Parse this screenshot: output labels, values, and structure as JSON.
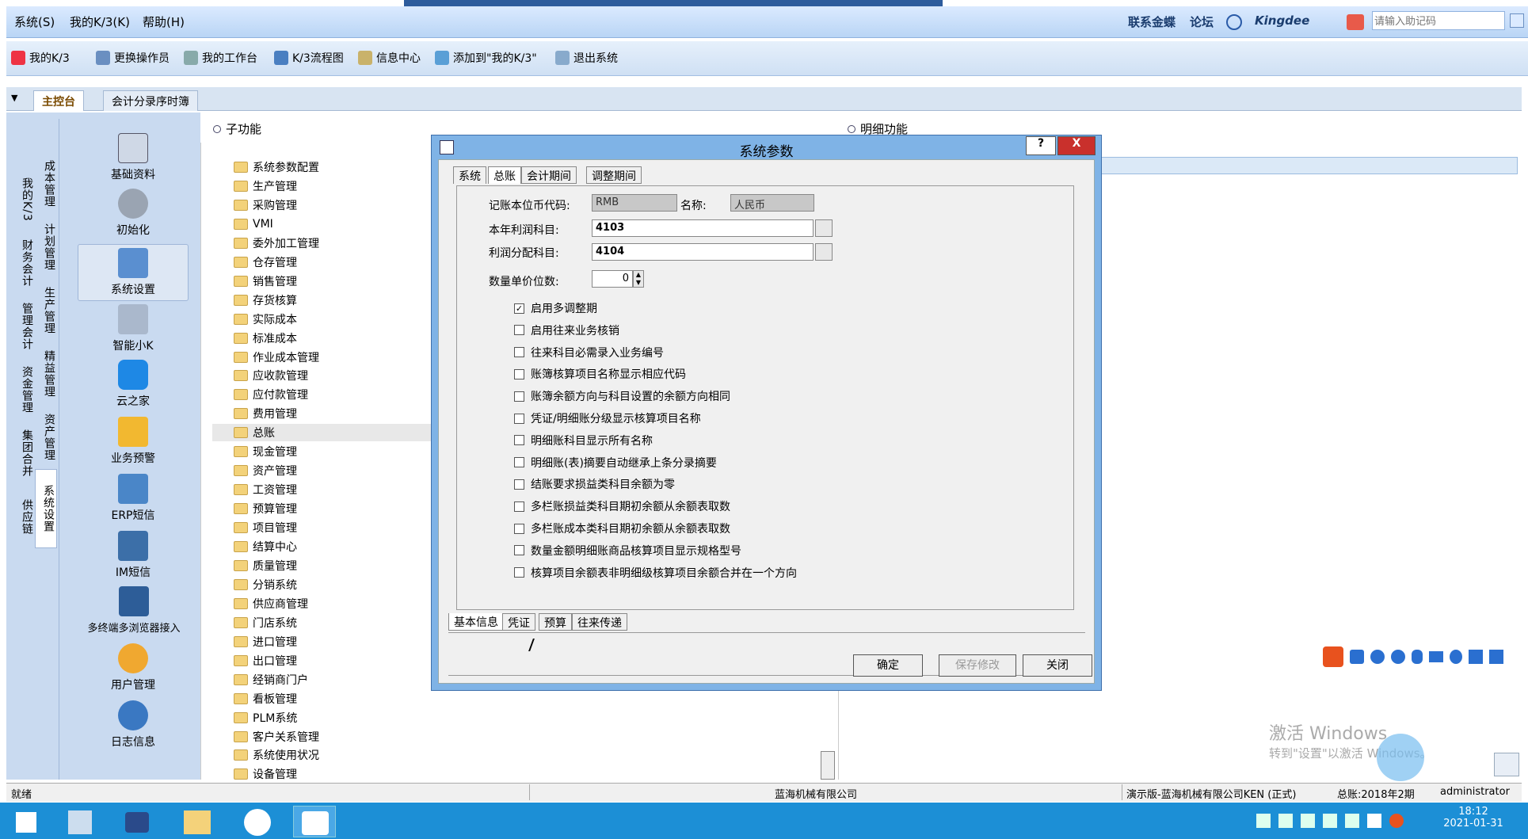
{
  "menubar": {
    "items": [
      "系统(S)",
      "我的K/3(K)",
      "帮助(H)"
    ],
    "links": [
      "联系金蝶",
      "论坛"
    ],
    "brand": "Kingdee",
    "search_placeholder": "请输入助记码"
  },
  "toolbar": {
    "items": [
      "我的K/3",
      "更换操作员",
      "我的工作台",
      "K/3流程图",
      "信息中心",
      "添加到\"我的K/3\"",
      "退出系统"
    ]
  },
  "main_tabs": [
    "主控台",
    "会计分录序时簿"
  ],
  "left_panel": {
    "vertical_tabs": [
      "我的K/3",
      "财务会计",
      "管理会计",
      "资金管理",
      "集团合并",
      "供应链"
    ],
    "vertical_tabs2": [
      "成本管理",
      "计划管理",
      "生产管理",
      "精益管理",
      "资产管理",
      "系统设置"
    ],
    "items": [
      "基础资料",
      "初始化",
      "系统设置",
      "智能小K",
      "云之家",
      "业务预警",
      "ERP短信",
      "IM短信",
      "多终端多浏览器接入",
      "用户管理",
      "日志信息"
    ]
  },
  "tree": {
    "header": "子功能",
    "items": [
      "系统参数配置",
      "生产管理",
      "采购管理",
      "VMI",
      "委外加工管理",
      "仓存管理",
      "销售管理",
      "存货核算",
      "实际成本",
      "标准成本",
      "作业成本管理",
      "应收款管理",
      "应付款管理",
      "费用管理",
      "总账",
      "现金管理",
      "资产管理",
      "工资管理",
      "预算管理",
      "项目管理",
      "结算中心",
      "质量管理",
      "分销系统",
      "供应商管理",
      "门店系统",
      "进口管理",
      "出口管理",
      "经销商门户",
      "看板管理",
      "PLM系统",
      "客户关系管理",
      "系统使用状况",
      "设备管理"
    ],
    "selected": "总账"
  },
  "detail": {
    "header": "明细功能"
  },
  "dialog": {
    "title": "系统参数",
    "help": "?",
    "close": "X",
    "top_tabs": [
      "系统",
      "总账",
      "会计期间",
      "调整期间"
    ],
    "fields": {
      "currency_label": "记账本位币代码:",
      "currency_value": "RMB",
      "name_label": "名称:",
      "name_value": "人民币",
      "profit_label": "本年利润科目:",
      "profit_value": "4103",
      "dist_label": "利润分配科目:",
      "dist_value": "4104",
      "decimals_label": "数量单价位数:",
      "decimals_value": "0"
    },
    "checkboxes": [
      {
        "label": "启用多调整期",
        "checked": true
      },
      {
        "label": "启用往来业务核销",
        "checked": false
      },
      {
        "label": "往来科目必需录入业务编号",
        "checked": false
      },
      {
        "label": "账簿核算项目名称显示相应代码",
        "checked": false
      },
      {
        "label": "账簿余额方向与科目设置的余额方向相同",
        "checked": false
      },
      {
        "label": "凭证/明细账分级显示核算项目名称",
        "checked": false
      },
      {
        "label": "明细账科目显示所有名称",
        "checked": false
      },
      {
        "label": "明细账(表)摘要自动继承上条分录摘要",
        "checked": false
      },
      {
        "label": "结账要求损益类科目余额为零",
        "checked": false
      },
      {
        "label": "多栏账损益类科目期初余额从余额表取数",
        "checked": false
      },
      {
        "label": "多栏账成本类科目期初余额从余额表取数",
        "checked": false
      },
      {
        "label": "数量金额明细账商品核算项目显示规格型号",
        "checked": false
      },
      {
        "label": "核算项目余额表非明细级核算项目余额合并在一个方向",
        "checked": false
      }
    ],
    "bottom_tabs": [
      "基本信息",
      "凭证",
      "预算",
      "往来传递"
    ],
    "buttons": {
      "ok": "确定",
      "save": "保存修改",
      "close": "关闭"
    }
  },
  "watermark": {
    "line1": "激活 Windows",
    "line2": "转到\"设置\"以激活 Windows。"
  },
  "statusbar": {
    "ready": "就绪",
    "company": "蓝海机械有限公司",
    "account": "演示版-蓝海机械有限公司KEN (正式)",
    "period": "总账:2018年2期",
    "user": "administrator"
  },
  "taskbar": {
    "time": "18:12",
    "date": "2021-01-31"
  },
  "colors": {
    "title_blue": "#7fb3e6",
    "taskbar": "#1c8fd6",
    "sogou": "#e8521e"
  }
}
